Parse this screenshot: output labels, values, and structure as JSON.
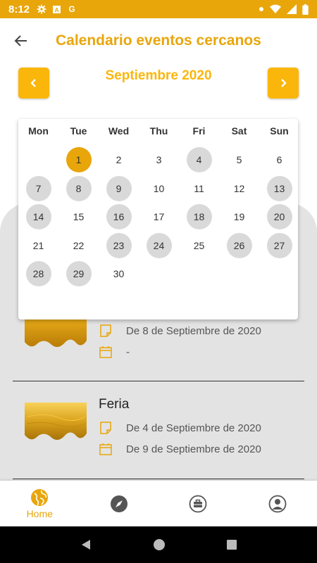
{
  "status_bar": {
    "time": "8:12",
    "icons": [
      "gear-icon",
      "a-icon",
      "g-icon"
    ],
    "right_icons": [
      "dot-icon",
      "wifi-icon",
      "signal-icon",
      "battery-icon"
    ]
  },
  "header": {
    "title": "Calendario eventos cercanos"
  },
  "calendar": {
    "month_label": "Septiembre 2020",
    "weekdays": [
      "Mon",
      "Tue",
      "Wed",
      "Thu",
      "Fri",
      "Sat",
      "Sun"
    ],
    "days": [
      "1",
      "2",
      "3",
      "4",
      "5",
      "6",
      "7",
      "8",
      "9",
      "10",
      "11",
      "12",
      "13",
      "14",
      "15",
      "16",
      "17",
      "18",
      "19",
      "20",
      "21",
      "22",
      "23",
      "24",
      "25",
      "26",
      "27",
      "28",
      "29",
      "30"
    ],
    "first_weekday_offset": 1,
    "today": "1",
    "event_days": [
      "4",
      "7",
      "8",
      "9",
      "13",
      "14",
      "16",
      "18",
      "20",
      "23",
      "24",
      "26",
      "27",
      "28",
      "29"
    ]
  },
  "events": [
    {
      "title": "",
      "date_line": "De 8 de Septiembre de 2020",
      "end_line": "-"
    },
    {
      "title": "Feria",
      "date_line": "De 4 de Septiembre de 2020",
      "end_line": "De 9 de Septiembre de 2020"
    }
  ],
  "bottom_nav": {
    "items": [
      {
        "label": "Home",
        "icon": "globe-icon"
      },
      {
        "label": "",
        "icon": "compass-icon"
      },
      {
        "label": "",
        "icon": "briefcase-icon"
      },
      {
        "label": "",
        "icon": "user-icon"
      }
    ]
  },
  "colors": {
    "primary": "#e8a60b",
    "accent": "#fbb60b",
    "event_day": "#d9d9d9",
    "sheet": "#e3e3e3"
  }
}
